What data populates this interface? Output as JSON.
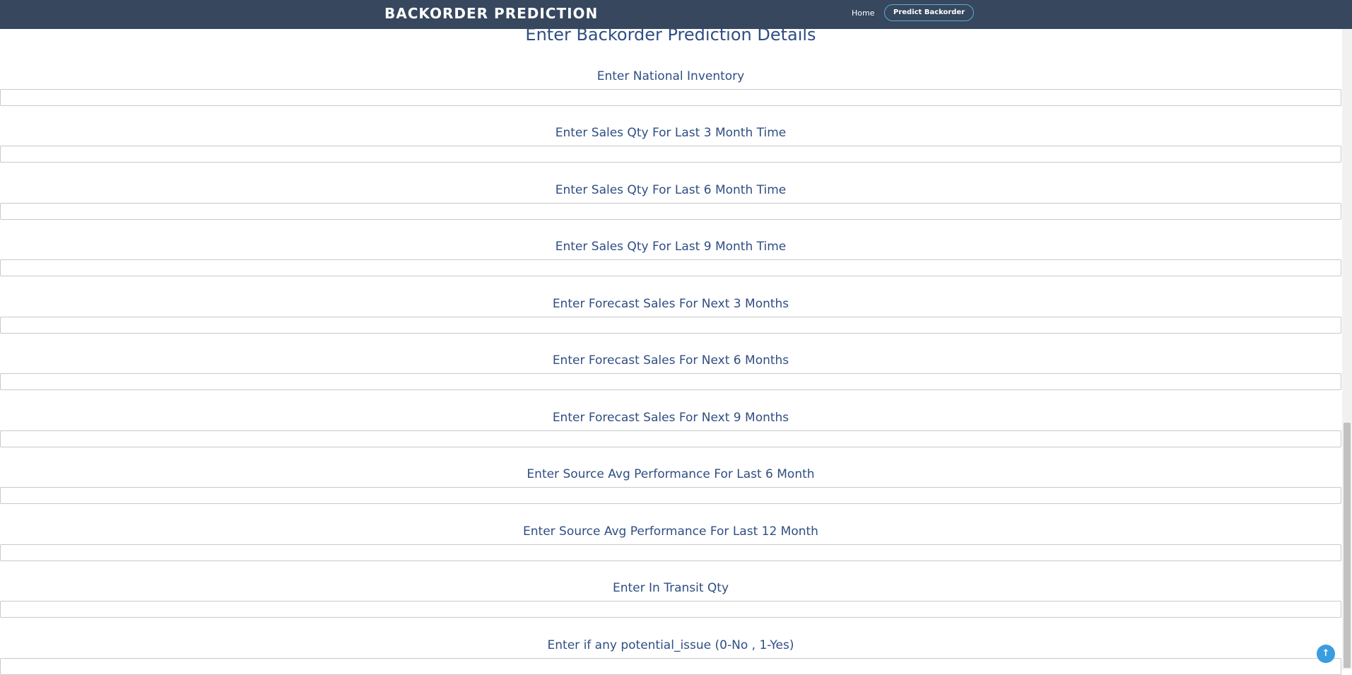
{
  "navbar": {
    "brand": "BACKORDER PREDICTION",
    "home_label": "Home",
    "predict_label": "Predict Backorder"
  },
  "form": {
    "title": "Enter Backorder Prediction Details",
    "fields": [
      {
        "label": "Enter National Inventory"
      },
      {
        "label": "Enter Sales Qty For Last 3 Month Time"
      },
      {
        "label": "Enter Sales Qty For Last 6 Month Time"
      },
      {
        "label": "Enter Sales Qty For Last 9 Month Time"
      },
      {
        "label": "Enter Forecast Sales For Next 3 Months"
      },
      {
        "label": "Enter Forecast Sales For Next 6 Months"
      },
      {
        "label": "Enter Forecast Sales For Next 9 Months"
      },
      {
        "label": "Enter Source Avg Performance For Last 6 Month"
      },
      {
        "label": "Enter Source Avg Performance For Last 12 Month"
      },
      {
        "label": "Enter In Transit Qty"
      },
      {
        "label": "Enter if any potential_issue (0-No , 1-Yes)"
      }
    ]
  },
  "scroll_to_top": {
    "icon": "arrow-up-icon",
    "glyph": "↑"
  },
  "colors": {
    "navbar_bg": "#36475e",
    "heading_text": "#2f4e83",
    "accent": "#3b9de0"
  }
}
